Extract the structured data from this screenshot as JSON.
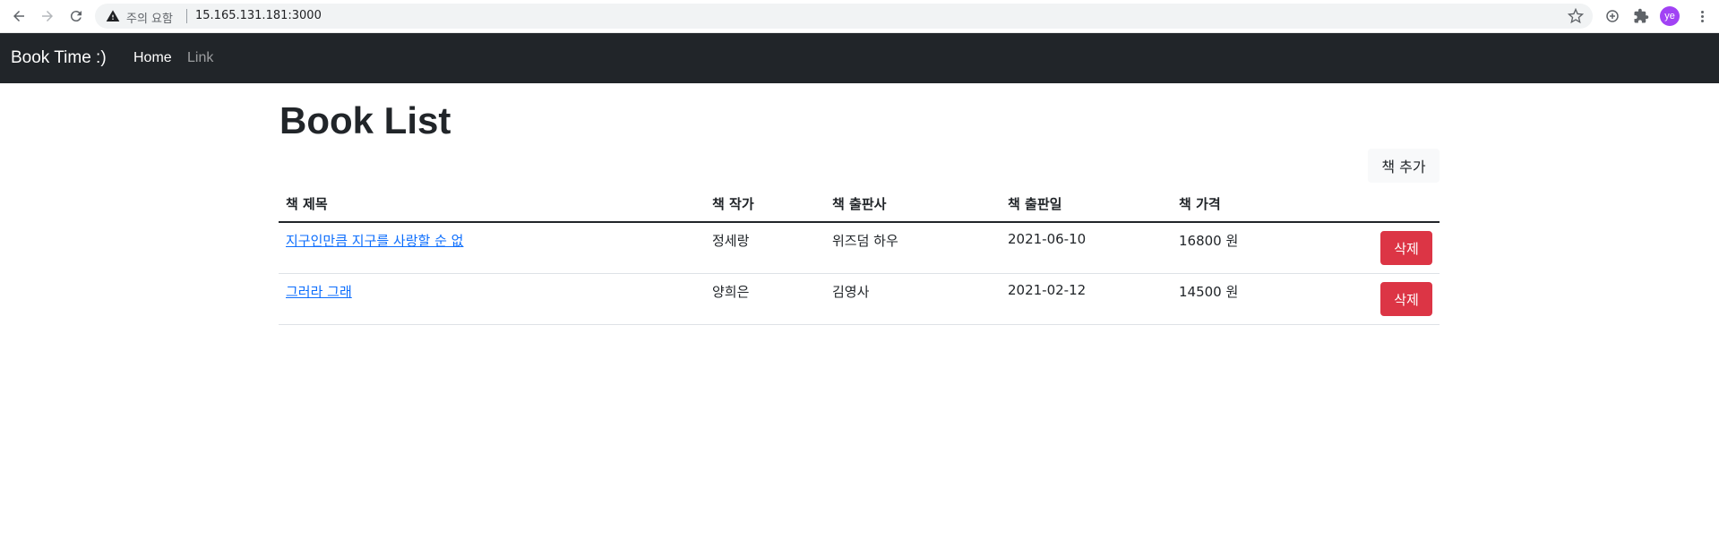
{
  "browser": {
    "warning_text": "주의 요함",
    "url": "15.165.131.181:3000",
    "profile_initials": "ye",
    "icons": [
      "back-arrow-icon",
      "forward-arrow-icon",
      "reload-icon",
      "warning-icon",
      "star-icon",
      "extension-sync-icon",
      "puzzle-icon",
      "menu-dots-icon"
    ]
  },
  "navbar": {
    "brand": "Book Time :)",
    "links": [
      "Home",
      "Link"
    ]
  },
  "page": {
    "title": "Book List",
    "add_button": "책 추가"
  },
  "table": {
    "headers": [
      "책 제목",
      "책 작가",
      "책 출판사",
      "책 출판일",
      "책 가격"
    ],
    "rows": [
      {
        "title": "지구인만큼 지구를 사랑할 순 없",
        "author": "정세랑",
        "publisher": "위즈덤 하우",
        "date": "2021-06-10",
        "price": "16800 원",
        "action": "삭제"
      },
      {
        "title": "그러라 그래",
        "author": "양희은",
        "publisher": "김영사",
        "date": "2021-02-12",
        "price": "14500 원",
        "action": "삭제"
      }
    ]
  },
  "colors": {
    "navbar_bg": "#212529",
    "delete_button": "#dc3545",
    "link": "#0d6efd",
    "avatar": "#a142f4"
  }
}
